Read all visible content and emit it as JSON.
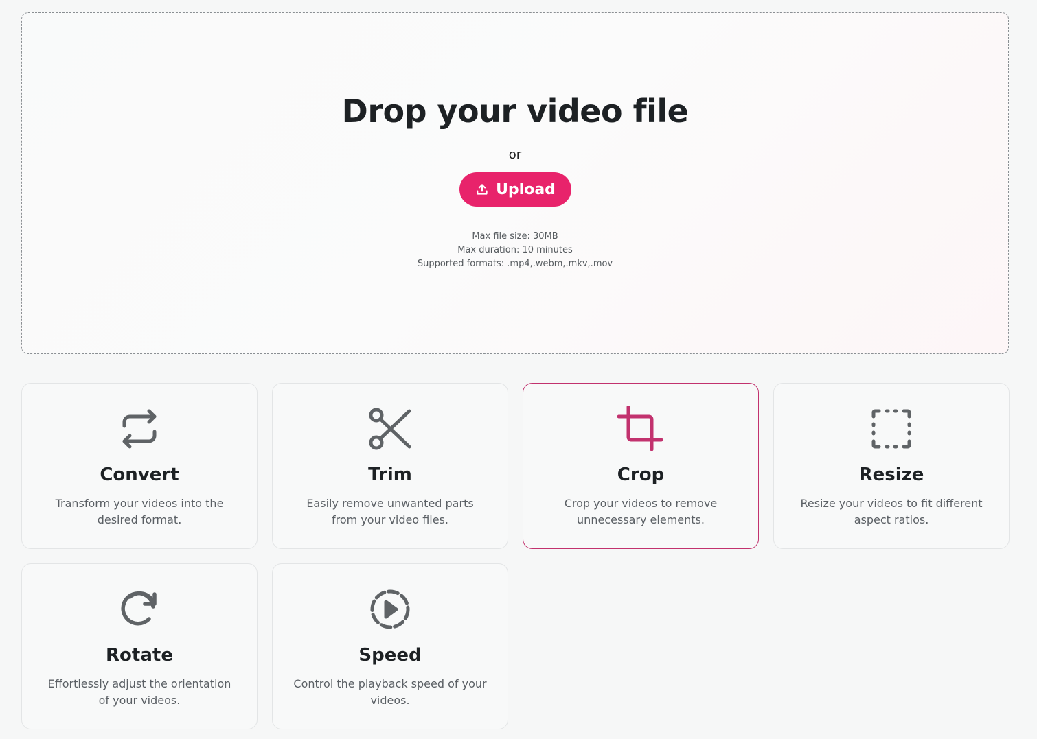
{
  "dropzone": {
    "title": "Drop your video file",
    "or_text": "or",
    "upload_label": "Upload",
    "max_size": "Max file size: 30MB",
    "max_duration": "Max duration: 10 minutes",
    "formats": "Supported formats: .mp4,.webm,.mkv,.mov"
  },
  "colors": {
    "accent": "#e8236b",
    "active_border": "#c2326e",
    "icon_gray": "#5f6366",
    "icon_active": "#c2326e"
  },
  "tools": [
    {
      "title": "Convert",
      "description": "Transform your videos into the desired format.",
      "icon": "repeat-arrows-icon",
      "active": false
    },
    {
      "title": "Trim",
      "description": "Easily remove unwanted parts from your video files.",
      "icon": "scissors-icon",
      "active": false
    },
    {
      "title": "Crop",
      "description": "Crop your videos to remove unnecessary elements.",
      "icon": "crop-icon",
      "active": true
    },
    {
      "title": "Resize",
      "description": "Resize your videos to fit different aspect ratios.",
      "icon": "dashed-square-icon",
      "active": false
    },
    {
      "title": "Rotate",
      "description": "Effortlessly adjust the orientation of your videos.",
      "icon": "rotate-cw-icon",
      "active": false
    },
    {
      "title": "Speed",
      "description": "Control the playback speed of your videos.",
      "icon": "dashed-play-circle-icon",
      "active": false
    }
  ]
}
